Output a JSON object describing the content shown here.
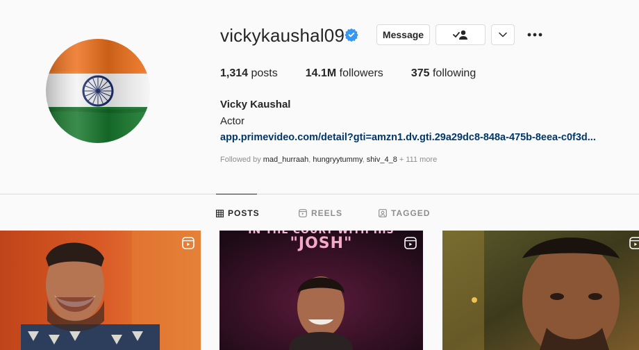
{
  "profile": {
    "username": "vickykaushal09",
    "full_name": "Vicky Kaushal",
    "category": "Actor",
    "link": "app.primevideo.com/detail?gti=amzn1.dv.gti.29a29dc8-848a-475b-8eea-c0f3d...",
    "verified": true
  },
  "actions": {
    "message_label": "Message",
    "following_icon": "person-check-icon",
    "suggest_icon": "chevron-down-icon",
    "more_icon": "more-horizontal-icon"
  },
  "stats": {
    "posts_num": "1,314",
    "posts_label": "posts",
    "followers_num": "14.1M",
    "followers_label": "followers",
    "following_num": "375",
    "following_label": "following"
  },
  "followed_by": {
    "prefix": "Followed by",
    "names": [
      "mad_hurraah",
      "hungryytummy",
      "shiv_4_8"
    ],
    "more": "+ 111 more"
  },
  "tabs": [
    {
      "label": "POSTS",
      "icon": "grid-icon",
      "active": true
    },
    {
      "label": "REELS",
      "icon": "reels-icon",
      "active": false
    },
    {
      "label": "TAGGED",
      "icon": "tagged-icon",
      "active": false
    }
  ],
  "posts": [
    {
      "type": "reel",
      "overlay_text": ""
    },
    {
      "type": "reel",
      "overlay_text_top": "IN THE COURT WITH HIS",
      "overlay_text": "\"JOSH\""
    },
    {
      "type": "reel",
      "overlay_text": ""
    }
  ],
  "colors": {
    "accent_link": "#00376b",
    "verified_blue": "#3897f0",
    "saffron": "#f47a20",
    "green": "#1a7a2a",
    "chakra_navy": "#1b2a6b"
  }
}
